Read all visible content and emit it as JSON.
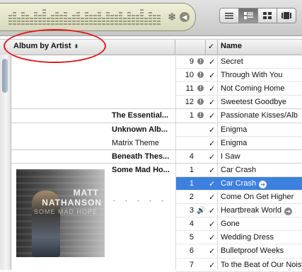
{
  "header": {
    "sort_column": "Album by Artist",
    "sort_arrows": "⬍",
    "check_column": "✓",
    "name_column": "Name"
  },
  "toolbar": {
    "visualizer_icon": "snowflake-icon",
    "view_buttons": [
      "list-view-icon",
      "album-list-view-icon",
      "grid-view-icon",
      "cover-flow-icon"
    ],
    "active_view": "album-list-view-icon"
  },
  "annotation_color": "#e01b1b",
  "selection_color": "#3d80df",
  "rows": [
    {
      "album": "",
      "num": "9",
      "chk": "✓",
      "name": "Secret",
      "status": "!"
    },
    {
      "album": "",
      "num": "10",
      "chk": "✓",
      "name": "Through With You",
      "status": "!"
    },
    {
      "album": "",
      "num": "11",
      "chk": "✓",
      "name": "Not Coming Home",
      "status": "!"
    },
    {
      "album": "",
      "num": "12",
      "chk": "✓",
      "name": "Sweetest Goodbye",
      "status": "!"
    },
    {
      "album": "The Essential...",
      "num": "1",
      "chk": "✓",
      "name": "Passionate Kisses/Alb",
      "status": "!"
    },
    {
      "album": "Unknown Alb...",
      "num": "",
      "chk": "✓",
      "name": "Enigma",
      "status": ""
    },
    {
      "album": "Matrix Theme",
      "num": "",
      "chk": "✓",
      "name": "Enigma",
      "status": ""
    },
    {
      "album": "Beneath Thes...",
      "num": "4",
      "chk": "✓",
      "name": "I Saw",
      "status": ""
    },
    {
      "album": "Some Mad Ho...",
      "num": "1",
      "chk": "✓",
      "name": "Car Crash",
      "status": ""
    },
    {
      "album": "Matt Nathanson",
      "num": "1",
      "chk": "✓",
      "name": "Car Crash",
      "status": "",
      "selected": true
    },
    {
      "album": "",
      "num": "2",
      "chk": "✓",
      "name": "Come On Get Higher",
      "status": ""
    },
    {
      "album": "",
      "num": "3",
      "chk": "✓",
      "name": "Heartbreak World",
      "status": "playing"
    },
    {
      "album": "",
      "num": "4",
      "chk": "✓",
      "name": "Gone",
      "status": ""
    },
    {
      "album": "",
      "num": "5",
      "chk": "✓",
      "name": "Wedding Dress",
      "status": ""
    },
    {
      "album": "",
      "num": "6",
      "chk": "✓",
      "name": "Bulletproof Weeks",
      "status": ""
    },
    {
      "album": "",
      "num": "7",
      "chk": "✓",
      "name": "To the Beat of Our Noisy Hearts",
      "status": ""
    }
  ],
  "album_art": {
    "line1": "MATT",
    "line2": "NATHANSON",
    "line3": "SOME MAD HOPE"
  },
  "rating_dots": "• • • • •"
}
